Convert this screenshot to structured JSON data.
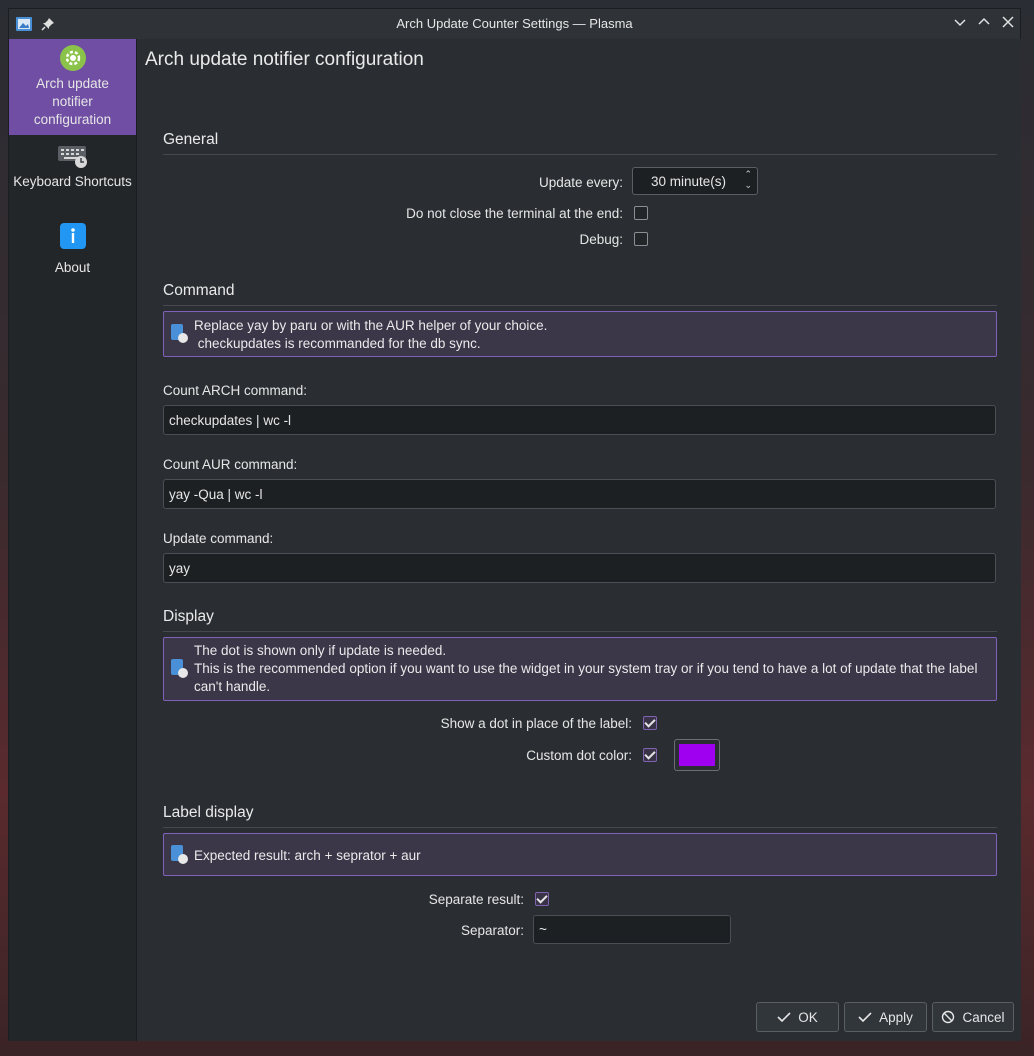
{
  "window": {
    "title": "Arch Update Counter Settings — Plasma"
  },
  "sidebar": {
    "items": [
      {
        "label": "Arch update notifier configuration",
        "icon": "gear-icon",
        "active": true
      },
      {
        "label": "Keyboard Shortcuts",
        "icon": "keyboard-icon",
        "active": false
      },
      {
        "label": "About",
        "icon": "info-icon",
        "active": false
      }
    ]
  },
  "page": {
    "title": "Arch update notifier configuration"
  },
  "general": {
    "heading": "General",
    "update_every_label": "Update every:",
    "update_every_value": "30 minute(s)",
    "no_close_label": "Do not close the terminal at the end:",
    "no_close_checked": false,
    "debug_label": "Debug:",
    "debug_checked": false
  },
  "command": {
    "heading": "Command",
    "info_line1": "Replace yay by paru or with the AUR helper of your choice.",
    "info_line2": " checkupdates is recommanded for the db sync.",
    "arch_label": "Count ARCH command:",
    "arch_value": "checkupdates | wc -l",
    "aur_label": "Count AUR command:",
    "aur_value": "yay -Qua | wc -l",
    "update_label": "Update command:",
    "update_value": "yay"
  },
  "display": {
    "heading": "Display",
    "info_line1": "The dot is shown only if update is needed.",
    "info_line2": "This is the recommended option if you want to use the widget in your system tray or if you tend to have a lot of update that the label can't handle.",
    "dot_label": "Show a dot in place of the label:",
    "dot_checked": true,
    "custom_color_label": "Custom dot color:",
    "custom_color_checked": true,
    "dot_color": "#a000f0"
  },
  "label_display": {
    "heading": "Label display",
    "info": "Expected result: arch + seprator + aur",
    "separate_label": "Separate result:",
    "separate_checked": true,
    "separator_label": "Separator:",
    "separator_value": "~"
  },
  "buttons": {
    "ok": "OK",
    "apply": "Apply",
    "cancel": "Cancel"
  },
  "colors": {
    "accent": "#6f4ea3",
    "message_border": "#7f62b8"
  }
}
